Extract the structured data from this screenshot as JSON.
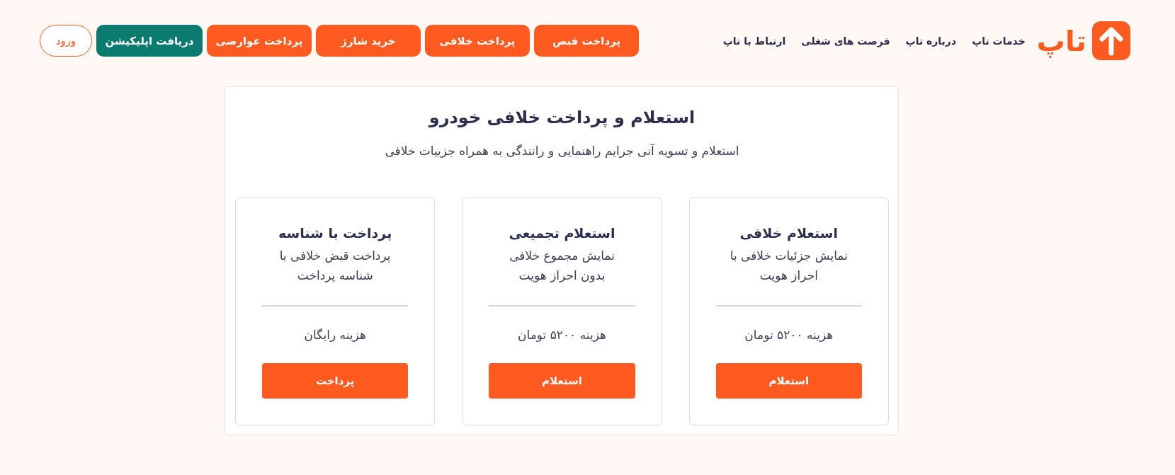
{
  "header": {
    "logo": {
      "wordmark": "تاپ"
    },
    "nav": [
      "خدمات تاپ",
      "درباره تاپ",
      "فرصت های شغلی",
      "ارتباط با تاپ"
    ],
    "actions": [
      {
        "label": "پرداخت قبض",
        "kind": "primary"
      },
      {
        "label": "پرداخت خلافی",
        "kind": "primary"
      },
      {
        "label": "خرید شارژ",
        "kind": "primary"
      },
      {
        "label": "پرداخت عوارضی",
        "kind": "primary"
      },
      {
        "label": "دریافت اپلیکیشن",
        "kind": "app"
      },
      {
        "label": "ورود",
        "kind": "outline"
      }
    ]
  },
  "main": {
    "title": "استعلام و پرداخت خلافی خودرو",
    "subtitle": "استعلام و تسویه آنی جرایم راهنمایی و رانندگی به همراه جزییات خلافی",
    "options": [
      {
        "title": "استعلام خلافی",
        "description": "نمایش جزئیات خلافی با احراز هویت",
        "price": "هزینه ۵۲۰۰ تومان",
        "button": "استعلام"
      },
      {
        "title": "استعلام تجمیعی",
        "description": "نمایش مجموع خلافی بدون احراز هویت",
        "price": "هزینه ۵۲۰۰ تومان",
        "button": "استعلام"
      },
      {
        "title": "پرداخت با شناسه",
        "description": "پرداخت قبض خلافی با شناسه پرداخت",
        "price": "هزینه رایگان",
        "button": "پرداخت"
      }
    ]
  }
}
